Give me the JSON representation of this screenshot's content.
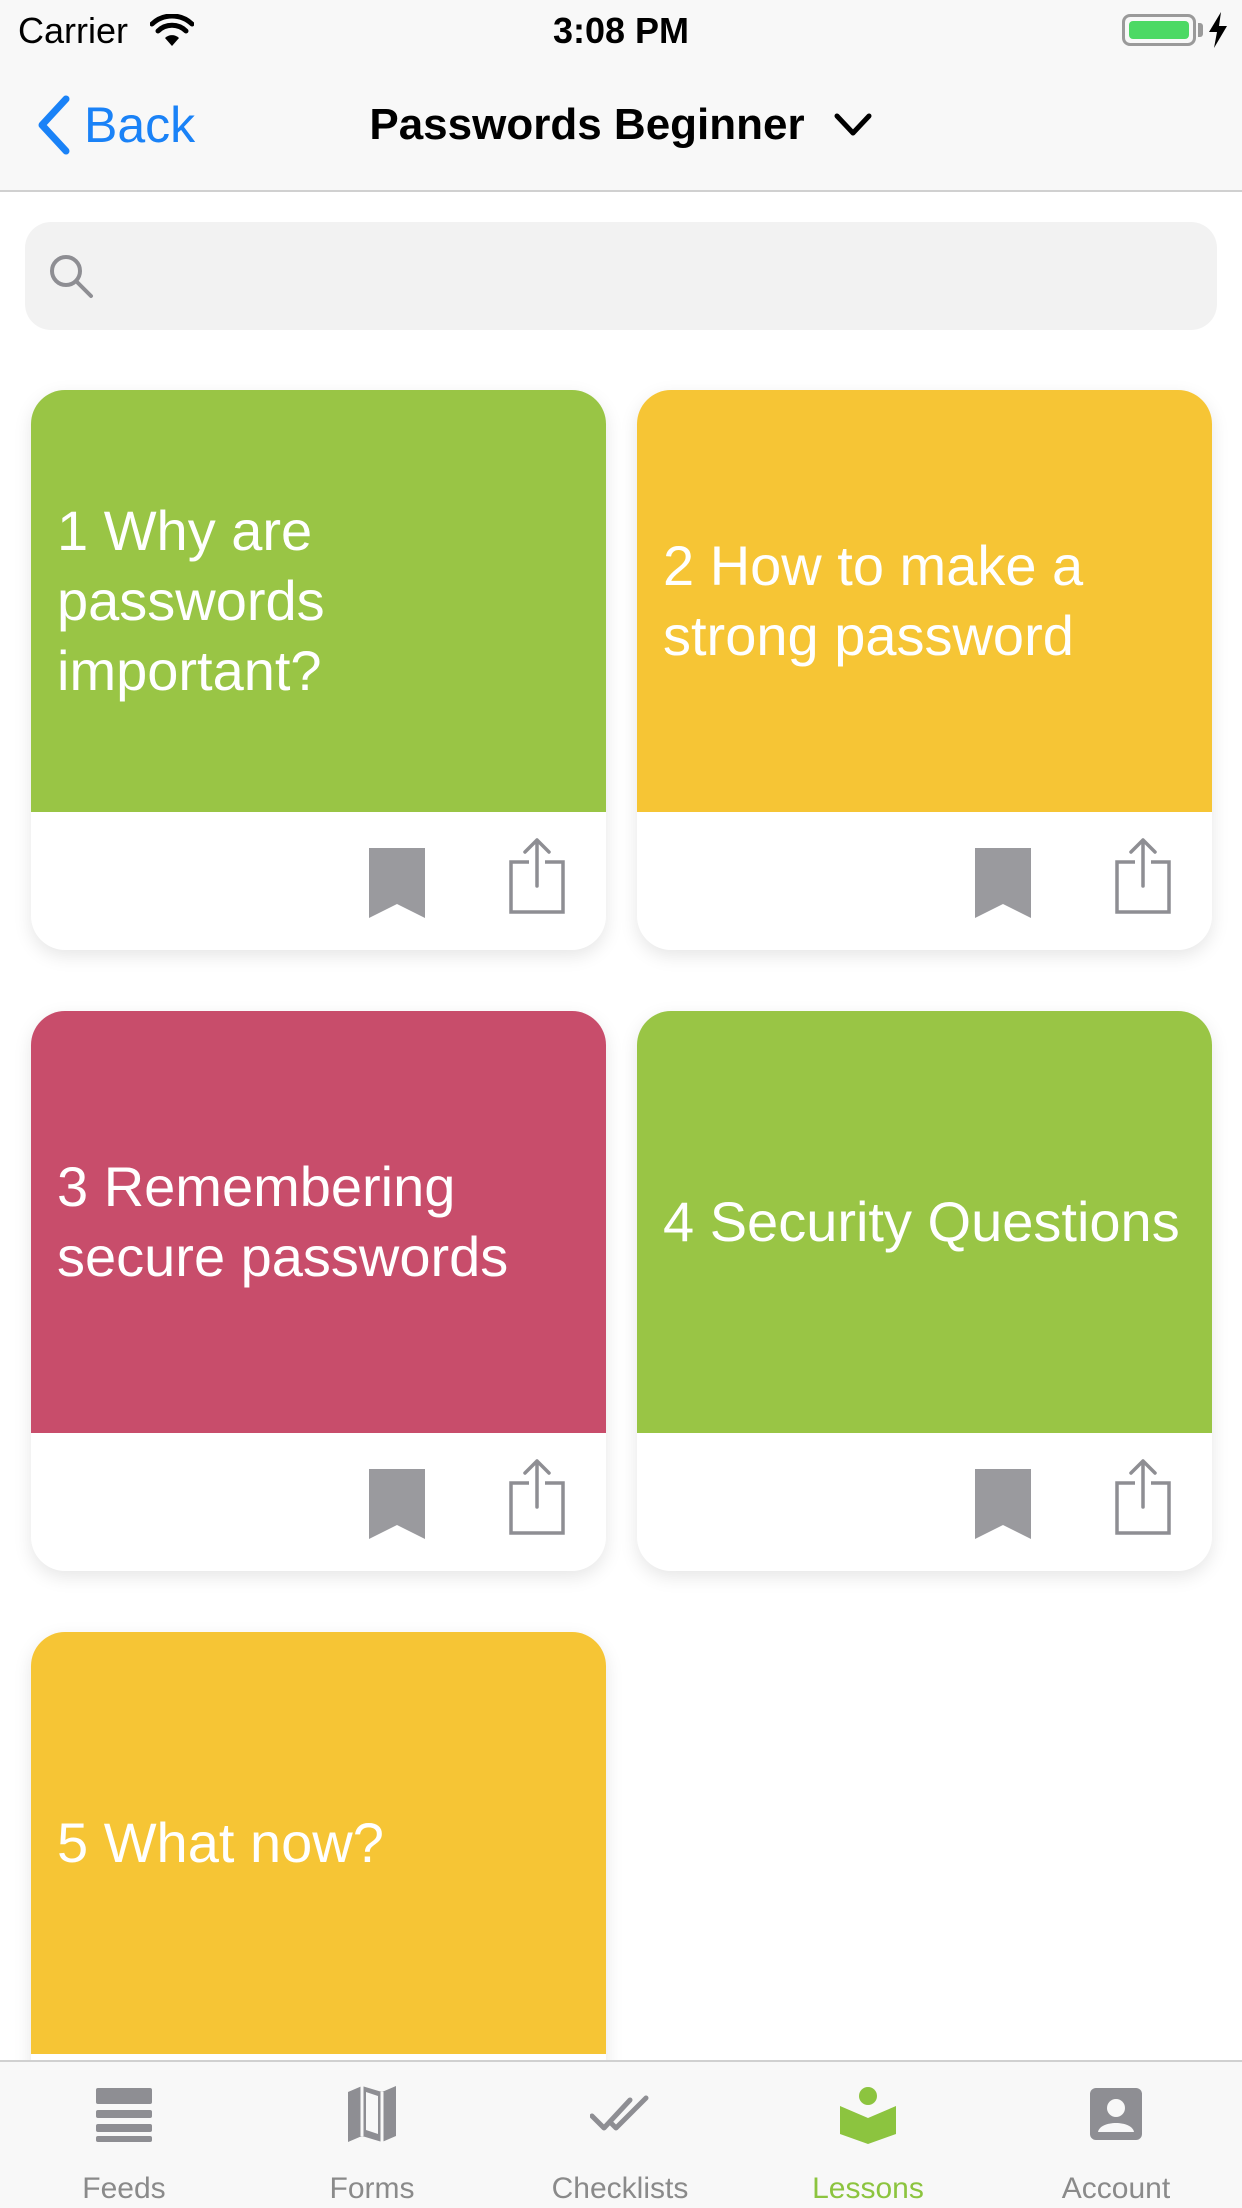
{
  "status_bar": {
    "carrier": "Carrier",
    "time": "3:08 PM"
  },
  "nav": {
    "back_label": "Back",
    "title": "Passwords Beginner"
  },
  "search": {
    "placeholder": "",
    "value": ""
  },
  "lessons": [
    {
      "title": "1 Why are passwords important?",
      "color": "#99c545"
    },
    {
      "title": "2 How to make a strong password",
      "color": "#f6c535"
    },
    {
      "title": "3 Remembering secure passwords",
      "color": "#c84d6b"
    },
    {
      "title": "4 Security Questions",
      "color": "#99c545"
    },
    {
      "title": "5 What now?",
      "color": "#f6c535"
    }
  ],
  "tabs": [
    {
      "label": "Feeds",
      "icon": "feeds-icon"
    },
    {
      "label": "Forms",
      "icon": "map-icon"
    },
    {
      "label": "Checklists",
      "icon": "double-check-icon"
    },
    {
      "label": "Lessons",
      "icon": "reader-icon",
      "active": true
    },
    {
      "label": "Account",
      "icon": "account-icon"
    }
  ],
  "colors": {
    "accent": "#1a82f7",
    "active_tab": "#8cc43f",
    "icon_gray": "#9a9a9e"
  }
}
